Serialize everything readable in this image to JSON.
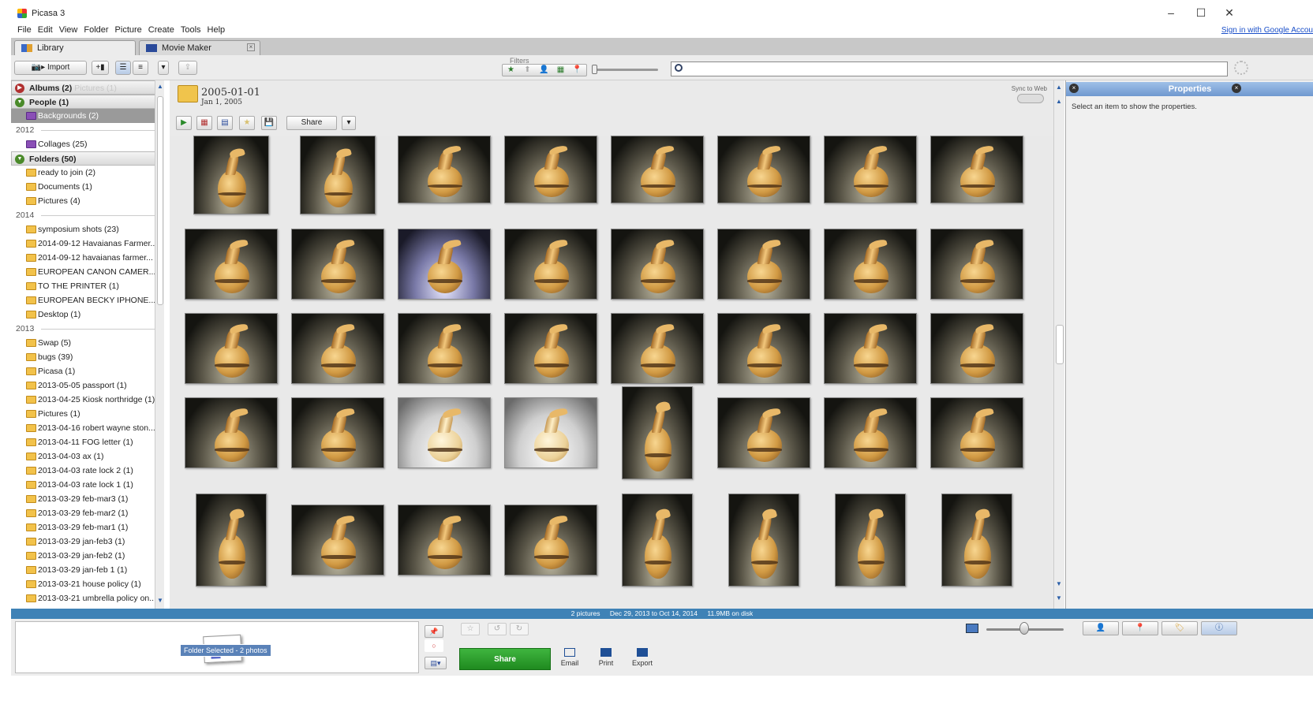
{
  "window": {
    "title": "Picasa 3",
    "controls": {
      "minimize": "–",
      "maximize": "☐",
      "close": "✕"
    }
  },
  "menu": {
    "items": [
      "File",
      "Edit",
      "View",
      "Folder",
      "Picture",
      "Create",
      "Tools",
      "Help"
    ],
    "signin": "Sign in with Google Accou"
  },
  "tabs": [
    {
      "label": "Library",
      "active": true
    },
    {
      "label": "Movie Maker",
      "active": false
    }
  ],
  "toolbar": {
    "import_label": "Import",
    "filters_label": "Filters",
    "search_placeholder": ""
  },
  "sidebar": {
    "albums": {
      "label": "Albums (2)",
      "ghost": "Pictures (1)"
    },
    "people": {
      "label": "People (1)",
      "items": [
        {
          "label": "Backgrounds (2)",
          "selected": true
        }
      ]
    },
    "year_2012": "2012",
    "collages": "Collages (25)",
    "folders": {
      "label": "Folders (50)"
    },
    "folder_items_top": [
      "ready to join (2)",
      "Documents (1)",
      "Pictures (4)"
    ],
    "year_2014": "2014",
    "folder_items_2014": [
      "symposium shots (23)",
      "2014-09-12 Havaianas Farmer...",
      "2014-09-12 havaianas farmer...",
      "EUROPEAN CANON CAMER...",
      "TO THE PRINTER (1)",
      "EUROPEAN BECKY IPHONE...",
      "Desktop (1)"
    ],
    "year_2013": "2013",
    "folder_items_2013": [
      "Swap (5)",
      "bugs (39)",
      "Picasa (1)",
      "2013-05-05 passport (1)",
      "2013-04-25 Kiosk northridge (1)",
      "Pictures (1)",
      "2013-04-16 robert wayne ston...",
      "2013-04-11 FOG letter (1)",
      "2013-04-03 ax (1)",
      "2013-04-03 rate lock 2 (1)",
      "2013-04-03 rate lock 1 (1)",
      "2013-03-29 feb-mar3 (1)",
      "2013-03-29 feb-mar2 (1)",
      "2013-03-29 feb-mar1 (1)",
      "2013-03-29 jan-feb3 (1)",
      "2013-03-29 jan-feb2 (1)",
      "2013-03-29 jan-feb 1 (1)",
      "2013-03-21 house policy (1)",
      "2013-03-21 umbrella policy on..."
    ]
  },
  "folder": {
    "title": "2005-01-01",
    "subtitle": "Jan 1, 2005",
    "sync_label": "Sync to Web",
    "share_label": "Share"
  },
  "properties": {
    "title": "Properties",
    "message": "Select an item to show the properties."
  },
  "status": {
    "count": "2 pictures",
    "range": "Dec 29, 2013 to Oct 14, 2014",
    "size": "11.9MB on disk"
  },
  "bottom": {
    "tray_badge": "Folder Selected - 2 photos",
    "share_label": "Share",
    "email_label": "Email",
    "print_label": "Print",
    "export_label": "Export"
  },
  "colors": {
    "status_bar": "#3f82b6",
    "share_green": "#2a9e2a",
    "properties_header": "#7aa2d6"
  }
}
